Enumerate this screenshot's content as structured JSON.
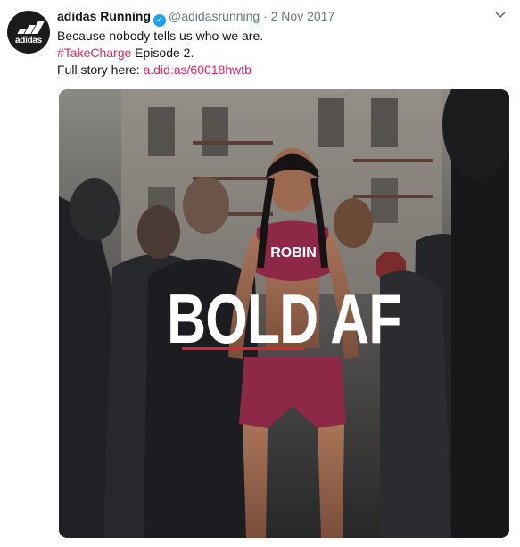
{
  "tweet": {
    "author_name": "adidas Running",
    "handle": "@adidasrunning",
    "separator": "·",
    "date": "2 Nov 2017",
    "avatar_brand": "adidas",
    "verified_icon": "verified-badge-icon",
    "menu_icon": "chevron-down-icon",
    "text_line1": "Because nobody tells us who we are.",
    "hashtag": "#TakeCharge",
    "text_line2_rest": " Episode 2.",
    "text_line3_prefix": "Full story here: ",
    "link": "a.did.as/60018hwtb",
    "link_color": "#e0245e",
    "verified_color": "#1da1f2"
  },
  "media": {
    "overlay_text": "BOLD AF",
    "shirt_text": "ROBIN",
    "accent_color": "#d9232e"
  }
}
